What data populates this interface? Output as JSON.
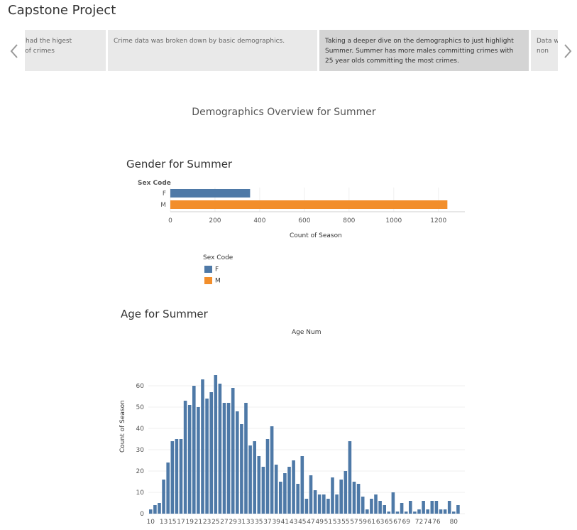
{
  "app": {
    "title": "Capstone Project"
  },
  "story": {
    "points": [
      {
        "text": "Summer had the higest majority of crimes",
        "active": false
      },
      {
        "text": "Crime data was broken down by basic demographics.",
        "active": false
      },
      {
        "text": "Taking a deeper dive on the demographics to just highlight Summer. Summer has more males committing crimes with 25 year olds committing the most crimes.",
        "active": true
      },
      {
        "text": "Data when vs. non",
        "active": false
      }
    ]
  },
  "icons": {
    "prev": "chevron-left-icon",
    "next": "chevron-right-icon"
  },
  "dashboard": {
    "title": "Demographics Overview for Summer"
  },
  "gender": {
    "title": "Gender for Summer",
    "row_header": "Sex Code",
    "x_axis_title": "Count of Season",
    "legend_title": "Sex Code",
    "legend": [
      {
        "label": "F",
        "color": "#4e79a7"
      },
      {
        "label": "M",
        "color": "#f28e2b"
      }
    ]
  },
  "age": {
    "title": "Age for Summer",
    "column_header": "Age Num",
    "y_axis_title": "Count of Season"
  },
  "chart_data": [
    {
      "type": "bar",
      "orientation": "horizontal",
      "title": "Gender for Summer",
      "categories": [
        "F",
        "M"
      ],
      "values": [
        357,
        1240
      ],
      "colors": [
        "#4e79a7",
        "#f28e2b"
      ],
      "xlabel": "Count of Season",
      "ylabel": "Sex Code",
      "xlim": [
        0,
        1300
      ],
      "xticks": [
        0,
        200,
        400,
        600,
        800,
        1000,
        1200
      ],
      "grid": true
    },
    {
      "type": "bar",
      "title": "Age for Summer",
      "xlabel": "Age Num",
      "ylabel": "Count of Season",
      "color": "#4e79a7",
      "categories": [
        10,
        11,
        12,
        13,
        14,
        15,
        16,
        17,
        18,
        19,
        20,
        21,
        22,
        23,
        24,
        25,
        26,
        27,
        28,
        29,
        30,
        31,
        32,
        33,
        34,
        35,
        36,
        37,
        38,
        39,
        40,
        41,
        42,
        43,
        44,
        45,
        46,
        47,
        48,
        49,
        50,
        51,
        52,
        53,
        54,
        55,
        56,
        57,
        58,
        59,
        60,
        61,
        62,
        63,
        64,
        65,
        66,
        67,
        68,
        69,
        70,
        71,
        72,
        73,
        74,
        75,
        76,
        77,
        78,
        79,
        80,
        81
      ],
      "values": [
        2,
        4,
        5,
        16,
        24,
        34,
        35,
        35,
        53,
        51,
        60,
        50,
        63,
        54,
        57,
        65,
        61,
        52,
        52,
        59,
        48,
        42,
        52,
        32,
        34,
        27,
        22,
        35,
        41,
        23,
        15,
        19,
        22,
        25,
        14,
        27,
        7,
        18,
        11,
        9,
        9,
        7,
        17,
        9,
        16,
        20,
        34,
        15,
        14,
        8,
        2,
        7,
        9,
        6,
        4,
        1,
        10,
        1,
        5,
        1,
        6,
        1,
        2,
        6,
        2,
        6,
        6,
        2,
        2,
        6,
        1,
        4
      ],
      "xticks": [
        10,
        13,
        15,
        17,
        19,
        21,
        23,
        25,
        27,
        29,
        31,
        33,
        35,
        37,
        39,
        41,
        43,
        45,
        47,
        49,
        51,
        53,
        55,
        57,
        59,
        61,
        63,
        65,
        67,
        69,
        72,
        74,
        76,
        80
      ],
      "ylim": [
        0,
        70
      ],
      "yticks": [
        0,
        10,
        20,
        30,
        40,
        50,
        60
      ],
      "grid": true
    }
  ]
}
